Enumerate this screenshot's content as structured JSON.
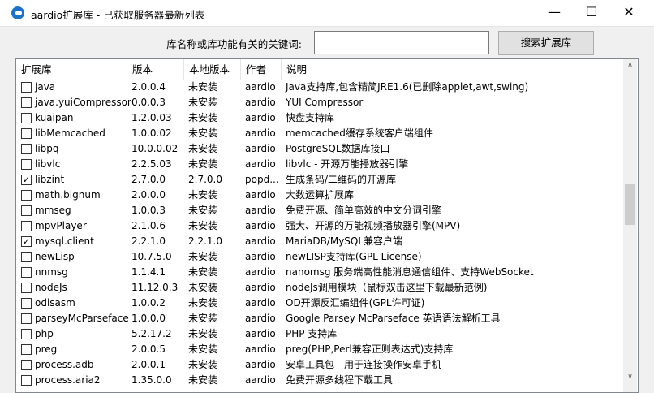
{
  "window": {
    "title": "aardio扩展库 - 已获取服务器最新列表",
    "minimize": "—",
    "maximize": "☐",
    "close": "✕"
  },
  "search": {
    "label": "库名称或库功能有关的关键词:",
    "value": "",
    "button": "搜索扩展库"
  },
  "columns": [
    "扩展库",
    "版本",
    "本地版本",
    "作者",
    "说明"
  ],
  "rows": [
    {
      "name": "java",
      "version": "2.0.0.4",
      "local": "未安装",
      "author": "aardio",
      "desc": "Java支持库,包含精简JRE1.6(已删除applet,awt,swing)",
      "checked": false
    },
    {
      "name": "java.yuiCompressor",
      "version": "0.0.0.3",
      "local": "未安装",
      "author": "aardio",
      "desc": "YUI Compressor",
      "checked": false
    },
    {
      "name": "kuaipan",
      "version": "1.2.0.03",
      "local": "未安装",
      "author": "aardio",
      "desc": "快盘支持库",
      "checked": false
    },
    {
      "name": "libMemcached",
      "version": "1.0.0.02",
      "local": "未安装",
      "author": "aardio",
      "desc": "memcached缓存系统客户端组件",
      "checked": false
    },
    {
      "name": "libpq",
      "version": "10.0.0.02",
      "local": "未安装",
      "author": "aardio",
      "desc": "PostgreSQL数据库接口",
      "checked": false
    },
    {
      "name": "libvlc",
      "version": "2.2.5.03",
      "local": "未安装",
      "author": "aardio",
      "desc": "libvlc - 开源万能播放器引擎",
      "checked": false
    },
    {
      "name": "libzint",
      "version": "2.7.0.0",
      "local": "2.7.0.0",
      "author": "popd...",
      "desc": "生成条码/二维码的开源库",
      "checked": true
    },
    {
      "name": "math.bignum",
      "version": "2.0.0.0",
      "local": "未安装",
      "author": "aardio",
      "desc": "大数运算扩展库",
      "checked": false
    },
    {
      "name": "mmseg",
      "version": "1.0.0.3",
      "local": "未安装",
      "author": "aardio",
      "desc": "免费开源、简单高效的中文分词引擎",
      "checked": false
    },
    {
      "name": "mpvPlayer",
      "version": "2.1.0.6",
      "local": "未安装",
      "author": "aardio",
      "desc": "强大、开源的万能视频播放器引擎(MPV)",
      "checked": false
    },
    {
      "name": "mysql.client",
      "version": "2.2.1.0",
      "local": "2.2.1.0",
      "author": "aardio",
      "desc": "MariaDB/MySQL兼容户端",
      "checked": true
    },
    {
      "name": "newLisp",
      "version": "10.7.5.0",
      "local": "未安装",
      "author": "aardio",
      "desc": "newLISP支持库(GPL License)",
      "checked": false
    },
    {
      "name": "nnmsg",
      "version": "1.1.4.1",
      "local": "未安装",
      "author": "aardio",
      "desc": "nanomsg 服务端高性能消息通信组件、支持WebSocket",
      "checked": false
    },
    {
      "name": "nodeJs",
      "version": "11.12.0.3",
      "local": "未安装",
      "author": "aardio",
      "desc": "nodeJs调用模块（鼠标双击这里下载最新范例)",
      "checked": false
    },
    {
      "name": "odisasm",
      "version": "1.0.0.2",
      "local": "未安装",
      "author": "aardio",
      "desc": "OD开源反汇编组件(GPL许可证)",
      "checked": false
    },
    {
      "name": "parseyMcParseface",
      "version": "1.0.0.0",
      "local": "未安装",
      "author": "aardio",
      "desc": "Google Parsey McParseface 英语语法解析工具",
      "checked": false
    },
    {
      "name": "php",
      "version": "5.2.17.2",
      "local": "未安装",
      "author": "aardio",
      "desc": "PHP 支持库",
      "checked": false
    },
    {
      "name": "preg",
      "version": "2.0.0.5",
      "local": "未安装",
      "author": "aardio",
      "desc": "preg(PHP,Perl兼容正则表达式)支持库",
      "checked": false
    },
    {
      "name": "process.adb",
      "version": "2.0.0.1",
      "local": "未安装",
      "author": "aardio",
      "desc": "安卓工具包 - 用于连接操作安卓手机",
      "checked": false
    },
    {
      "name": "process.aria2",
      "version": "1.35.0.0",
      "local": "未安装",
      "author": "aardio",
      "desc": "免费开源多线程下载工具",
      "checked": false
    }
  ],
  "scrollbar": {
    "position_fraction": 0.45
  }
}
